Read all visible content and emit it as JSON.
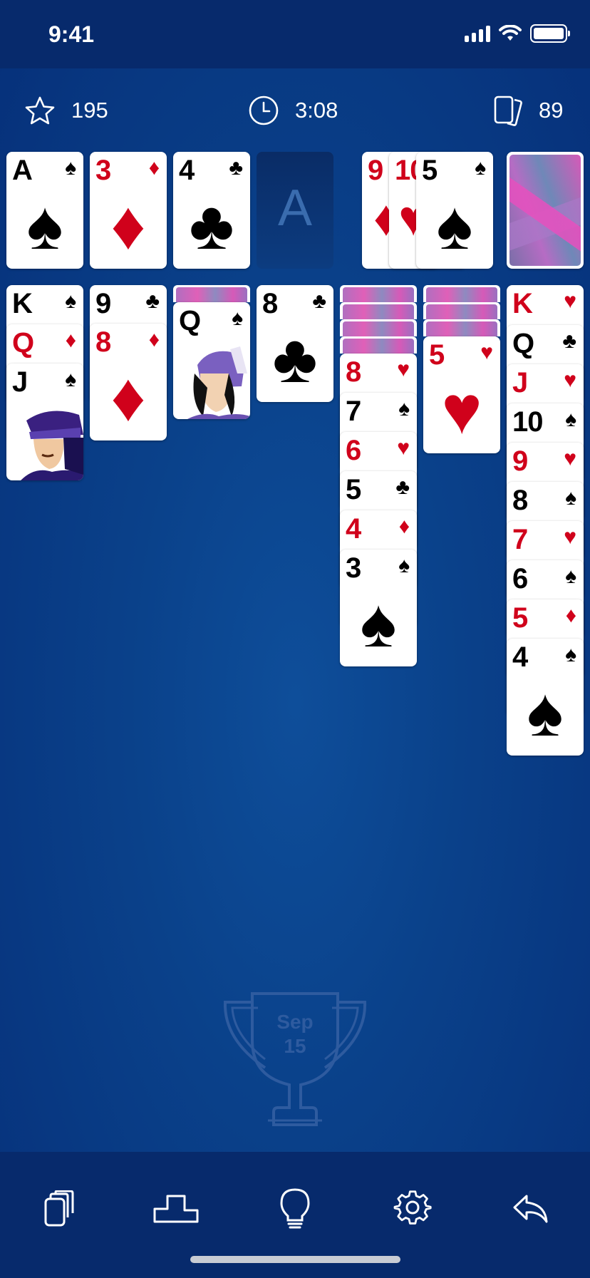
{
  "status_bar": {
    "time": "9:41"
  },
  "stats": {
    "score": "195",
    "timer": "3:08",
    "moves": "89"
  },
  "colors": {
    "background": "#0a418a",
    "bar": "#072a6c",
    "red_suit": "#d0011b",
    "black_suit": "#000000",
    "empty_slot_letter": "#3a6cae"
  },
  "foundations": [
    {
      "rank": "A",
      "suit": "♠"
    },
    {
      "rank": "3",
      "suit": "♦"
    },
    {
      "rank": "4",
      "suit": "♣"
    },
    {
      "empty_label": "A"
    }
  ],
  "waste": [
    {
      "rank": "9",
      "suit": "♦"
    },
    {
      "rank": "10",
      "suit": "♥"
    },
    {
      "rank": "5",
      "suit": "♠"
    }
  ],
  "stock": {
    "icon": "card-back"
  },
  "tableau": [
    {
      "face_down": 0,
      "cards": [
        {
          "rank": "K",
          "suit": "♠"
        },
        {
          "rank": "Q",
          "suit": "♦"
        },
        {
          "rank": "J",
          "suit": "♠"
        }
      ]
    },
    {
      "face_down": 0,
      "cards": [
        {
          "rank": "9",
          "suit": "♣"
        },
        {
          "rank": "8",
          "suit": "♦"
        }
      ]
    },
    {
      "face_down": 1,
      "cards": [
        {
          "rank": "Q",
          "suit": "♠"
        }
      ]
    },
    {
      "face_down": 0,
      "cards": [
        {
          "rank": "8",
          "suit": "♣"
        }
      ]
    },
    {
      "face_down": 4,
      "cards": [
        {
          "rank": "8",
          "suit": "♥"
        },
        {
          "rank": "7",
          "suit": "♠"
        },
        {
          "rank": "6",
          "suit": "♥"
        },
        {
          "rank": "5",
          "suit": "♣"
        },
        {
          "rank": "4",
          "suit": "♦"
        },
        {
          "rank": "3",
          "suit": "♠"
        }
      ]
    },
    {
      "face_down": 3,
      "cards": [
        {
          "rank": "5",
          "suit": "♥"
        }
      ]
    },
    {
      "face_down": 0,
      "cards": [
        {
          "rank": "K",
          "suit": "♥"
        },
        {
          "rank": "Q",
          "suit": "♣"
        },
        {
          "rank": "J",
          "suit": "♥"
        },
        {
          "rank": "10",
          "suit": "♠"
        },
        {
          "rank": "9",
          "suit": "♥"
        },
        {
          "rank": "8",
          "suit": "♠"
        },
        {
          "rank": "7",
          "suit": "♥"
        },
        {
          "rank": "6",
          "suit": "♠"
        },
        {
          "rank": "5",
          "suit": "♦"
        },
        {
          "rank": "4",
          "suit": "♠"
        }
      ]
    }
  ],
  "daily_trophy": {
    "month": "Sep",
    "day": "15"
  },
  "toolbar": [
    {
      "icon": "deal-icon"
    },
    {
      "icon": "podium-icon"
    },
    {
      "icon": "hint-bulb-icon"
    },
    {
      "icon": "settings-gear-icon"
    },
    {
      "icon": "undo-icon"
    }
  ]
}
